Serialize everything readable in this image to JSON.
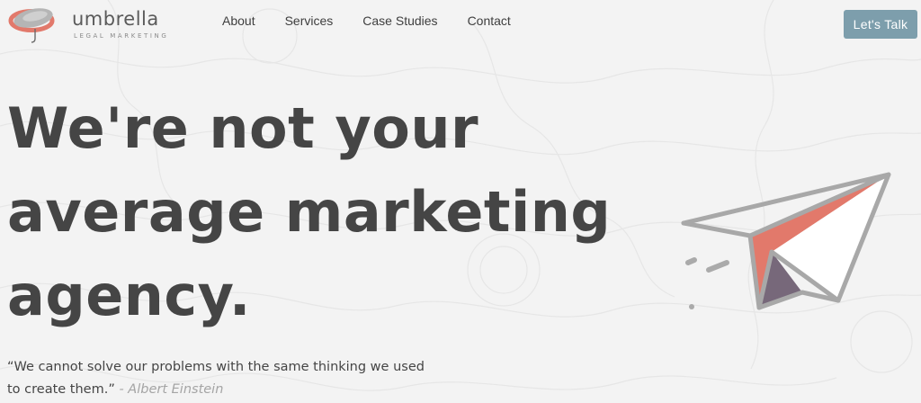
{
  "brand": {
    "name": "umbrella",
    "tagline": "LEGAL MARKETING",
    "colors": {
      "accent": "#e2796b",
      "cta": "#7d9eac",
      "text": "#454545",
      "muted": "#a5a5a5",
      "background": "#f3f3f3",
      "plane_shadow": "#7a6a7e"
    }
  },
  "nav": {
    "items": [
      {
        "label": "About"
      },
      {
        "label": "Services"
      },
      {
        "label": "Case Studies"
      },
      {
        "label": "Contact"
      }
    ],
    "cta_label": "Let's Talk"
  },
  "hero": {
    "title_lines": [
      "We're not your",
      "average marketing",
      "agency."
    ],
    "quote_text": "“We cannot solve our problems with the same thinking we used to create them.”",
    "quote_author": "- Albert Einstein"
  },
  "icons": {
    "logo": "umbrella-logo-icon",
    "illustration": "paper-plane-icon"
  }
}
